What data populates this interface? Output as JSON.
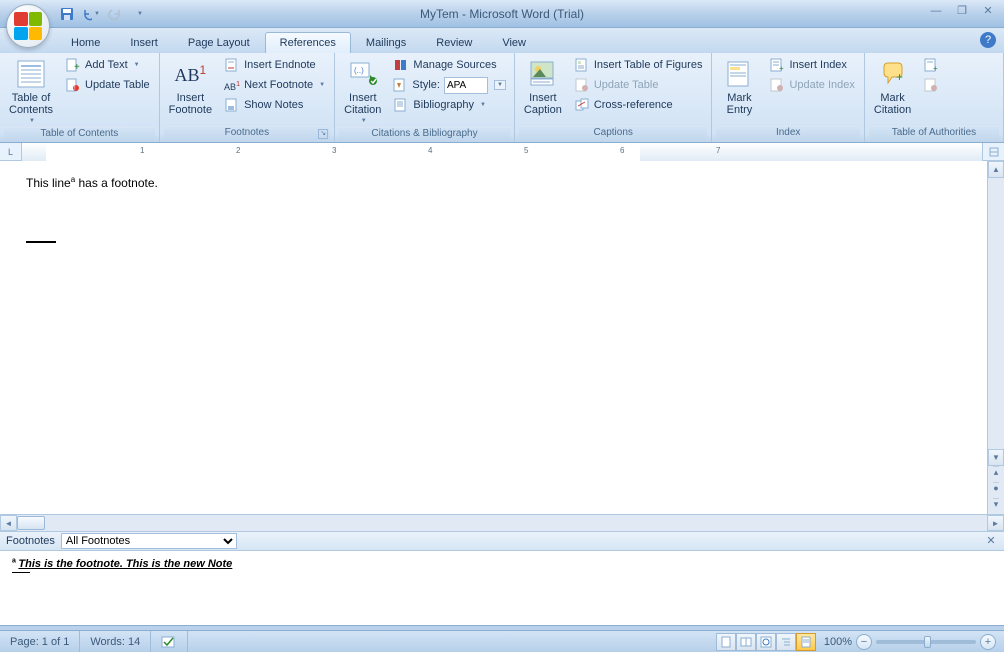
{
  "title": "MyTem - Microsoft Word (Trial)",
  "qat": {
    "save": "save",
    "undo": "undo",
    "redo": "redo"
  },
  "tabs": [
    "Home",
    "Insert",
    "Page Layout",
    "References",
    "Mailings",
    "Review",
    "View"
  ],
  "active_tab": "References",
  "ribbon": {
    "toc": {
      "label": "Table of Contents",
      "big": "Table of\nContents",
      "add_text": "Add Text",
      "update_table": "Update Table"
    },
    "footnotes": {
      "label": "Footnotes",
      "big": "Insert\nFootnote",
      "insert_endnote": "Insert Endnote",
      "next_footnote": "Next Footnote",
      "show_notes": "Show Notes"
    },
    "citations": {
      "label": "Citations & Bibliography",
      "big": "Insert\nCitation",
      "manage_sources": "Manage Sources",
      "style_label": "Style:",
      "style_value": "APA",
      "bibliography": "Bibliography"
    },
    "captions": {
      "label": "Captions",
      "big": "Insert\nCaption",
      "insert_tof": "Insert Table of Figures",
      "update_table": "Update Table",
      "cross_ref": "Cross-reference"
    },
    "index": {
      "label": "Index",
      "big": "Mark\nEntry",
      "insert_index": "Insert Index",
      "update_index": "Update Index"
    },
    "toa": {
      "label": "Table of Authorities",
      "big": "Mark\nCitation"
    }
  },
  "ruler_numbers": [
    "1",
    "2",
    "3",
    "4",
    "5",
    "6",
    "7"
  ],
  "document": {
    "body_text": "This line",
    "footnote_marker": "a",
    "body_suffix": " has a footnote."
  },
  "footnote_pane": {
    "header_label": "Footnotes",
    "dropdown_value": "All Footnotes",
    "note_marker": "a",
    "note_text": "This is the footnote. This is the new Note"
  },
  "status": {
    "page": "Page: 1 of 1",
    "words": "Words: 14",
    "zoom": "100%"
  }
}
